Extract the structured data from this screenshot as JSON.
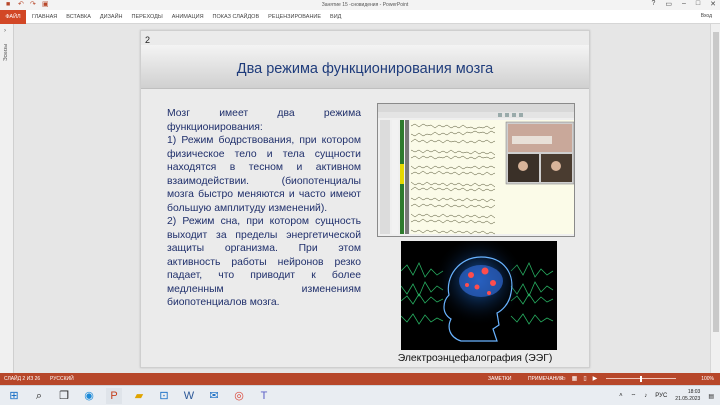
{
  "window": {
    "title": "Занятие 15 -сновидения - PowerPoint",
    "user": "Вход"
  },
  "ribbon": {
    "file_tab": "ФАЙЛ",
    "tabs": [
      "ГЛАВНАЯ",
      "ВСТАВКА",
      "ДИЗАЙН",
      "ПЕРЕХОДЫ",
      "АНИМАЦИЯ",
      "ПОКАЗ СЛАЙДОВ",
      "РЕЦЕНЗИРОВАНИЕ",
      "ВИД"
    ]
  },
  "left_panel": {
    "label": "Эскизы"
  },
  "slide": {
    "number": "2",
    "title": "Два режима функционирования мозга",
    "paragraphs": [
      "Мозг имеет два режима функционирования:",
      "1) Режим бодрствования, при котором физическое тело и тела сущности находятся в тесном и активном взаимодействии. (биопотенциалы мозга быстро меняются и часто имеют большую амплитуду изменений).",
      "2) Режим сна, при котором сущность выходит за пределы энергетической защиты организма. При этом активность работы нейронов резко падает, что приводит к более медленным изменениям биопотенциалов мозга."
    ],
    "caption": "Электроэнцефалография (ЭЭГ)"
  },
  "status_bar": {
    "slide_counter": "СЛАЙД 2 ИЗ 26",
    "language": "РУССКИЙ",
    "notes": "ЗАМЕТКИ",
    "comments": "ПРИМЕЧАНИЯ",
    "zoom": "100%",
    "zoom_level": 0.5
  },
  "taskbar": {
    "icons": [
      "windows-icon",
      "search-icon",
      "task-view-icon",
      "edge-icon",
      "powerpoint-icon",
      "folder-icon",
      "store-icon",
      "word-icon",
      "mail-icon",
      "chrome-icon",
      "teams-icon"
    ],
    "language": "РУС",
    "time": "18:03",
    "date": "21.05.2023"
  },
  "colors": {
    "accent": "#b7472a",
    "title_text": "#1f3c7b",
    "body_text": "#1f2f6b"
  }
}
